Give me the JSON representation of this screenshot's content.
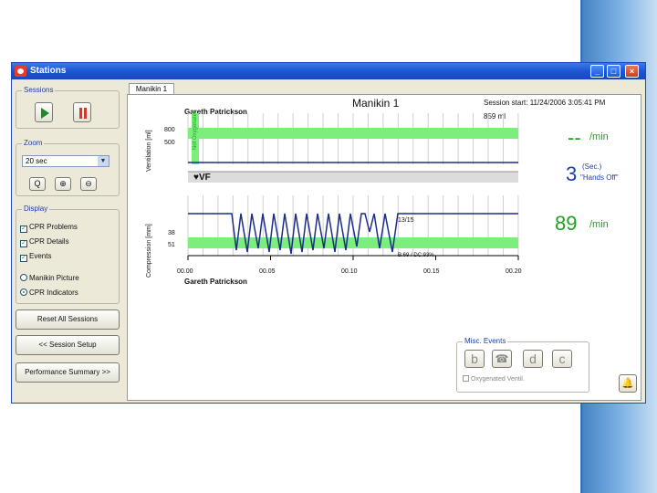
{
  "window": {
    "title": "Stations",
    "min": "_",
    "max": "□",
    "close": "×"
  },
  "sessions": {
    "label": "Sessions"
  },
  "zoom": {
    "label": "Zoom",
    "value": "20 sec",
    "arrow": "▼",
    "buttons": [
      "Q",
      "⊕",
      "⊖"
    ]
  },
  "display": {
    "label": "Display",
    "checks": [
      {
        "label": "CPR Problems",
        "mark": "✓"
      },
      {
        "label": "CPR Details",
        "mark": "✓"
      },
      {
        "label": "Events",
        "mark": "✓"
      }
    ],
    "radios": [
      {
        "label": "Manikin Picture"
      },
      {
        "label": "CPR Indicators"
      }
    ]
  },
  "buttons": {
    "reset": "Reset All Sessions",
    "setup": "<< Session Setup",
    "summary": "Performance Summary >>"
  },
  "tab": "Manikin 1",
  "header": {
    "manikin": "Manikin 1",
    "session_start": "Session start: 11/24/2006  3:05:41 PM",
    "ml": "859 ml",
    "name_top": "Gareth  Patrickson",
    "name_bottom": "Gareth  Patrickson"
  },
  "ventilation": {
    "axis_label": "Ventilation [ml]",
    "ticks": [
      "800",
      "500"
    ],
    "vertical_note": "Not Oxygenated",
    "rate": "--",
    "unit": "/min"
  },
  "event": {
    "label": "VF"
  },
  "compression": {
    "axis_label": "Compression [mm]",
    "ticks": [
      "38",
      "51"
    ],
    "annotation_count": "13/15",
    "annotation_ratio": "B:69 / DC:93%",
    "time_ticks": [
      "00.00",
      "00.05",
      "00.10",
      "00.15",
      "00.20"
    ],
    "rate": "89",
    "unit": "/min"
  },
  "hands_off": {
    "value": "3",
    "sec": "(Sec.)",
    "label": "\"Hands Off\""
  },
  "misc": {
    "label": "Misc. Events",
    "buttons": [
      "b",
      "☎",
      "d",
      "c"
    ],
    "oxygenated": "Oxygenated Ventil."
  },
  "colors": {
    "band": "#7cee7c",
    "accent_green": "#21a121",
    "accent_blue": "#1a3fa8",
    "trace": "#1b2d8a"
  }
}
